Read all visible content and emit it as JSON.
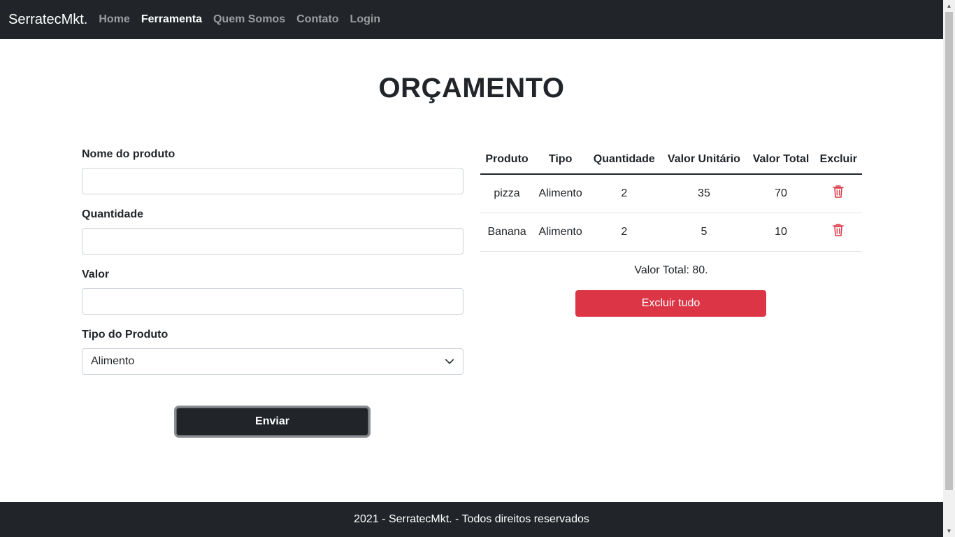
{
  "navbar": {
    "brand": "SerratecMkt.",
    "links": [
      "Home",
      "Ferramenta",
      "Quem Somos",
      "Contato",
      "Login"
    ],
    "active": "Ferramenta"
  },
  "page": {
    "title": "ORÇAMENTO"
  },
  "form": {
    "name_label": "Nome do produto",
    "name_value": "",
    "quantity_label": "Quantidade",
    "quantity_value": "",
    "value_label": "Valor",
    "value_value": "",
    "type_label": "Tipo do Produto",
    "type_selected": "Alimento",
    "submit_label": "Enviar"
  },
  "table": {
    "headers": [
      "Produto",
      "Tipo",
      "Quantidade",
      "Valor Unitário",
      "Valor Total",
      "Excluir"
    ],
    "rows": [
      {
        "produto": "pizza",
        "tipo": "Alimento",
        "quantidade": "2",
        "valor_unitario": "35",
        "valor_total": "70",
        "excluir_icon": "trash-icon"
      },
      {
        "produto": "Banana",
        "tipo": "Alimento",
        "quantidade": "2",
        "valor_unitario": "5",
        "valor_total": "10",
        "excluir_icon": "trash-icon"
      }
    ]
  },
  "summary": {
    "total_text": "Valor Total: 80.",
    "clear_label": "Excluir tudo"
  },
  "footer": {
    "text": "2021 - SerratecMkt. - Todos direitos reservados"
  },
  "colors": {
    "dark": "#212529",
    "danger": "#dc3545"
  }
}
